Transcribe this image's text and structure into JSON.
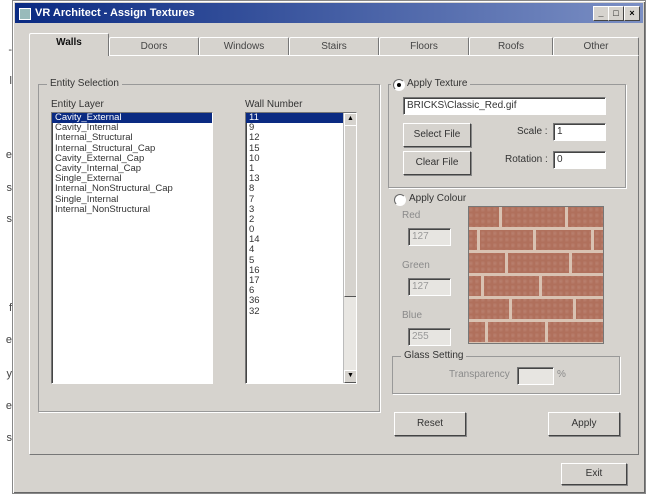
{
  "side_fragments": [
    {
      "text": "-"
    },
    {
      "text": "l"
    },
    {
      "text": "e"
    },
    {
      "text": "s"
    },
    {
      "text": "s"
    },
    {
      "text": "f"
    },
    {
      "text": "e"
    },
    {
      "text": "y"
    },
    {
      "text": "e"
    },
    {
      "text": "s"
    }
  ],
  "window": {
    "title": "VR Architect - Assign Textures",
    "buttons": {
      "minimize": "_",
      "maximize": "□",
      "close": "×"
    }
  },
  "tabs": [
    {
      "label": "Walls",
      "active": true
    },
    {
      "label": "Doors",
      "active": false
    },
    {
      "label": "Windows",
      "active": false
    },
    {
      "label": "Stairs",
      "active": false
    },
    {
      "label": "Floors",
      "active": false
    },
    {
      "label": "Roofs",
      "active": false
    },
    {
      "label": "Other",
      "active": false
    }
  ],
  "entity_selection": {
    "title": "Entity Selection",
    "entity_layer_label": "Entity Layer",
    "wall_number_label": "Wall Number",
    "entity_layers": [
      {
        "label": "Cavity_External",
        "selected": true
      },
      {
        "label": "Cavity_Internal",
        "selected": false
      },
      {
        "label": "Internal_Structural",
        "selected": false
      },
      {
        "label": "Internal_Structural_Cap",
        "selected": false
      },
      {
        "label": "Cavity_External_Cap",
        "selected": false
      },
      {
        "label": "Cavity_Internal_Cap",
        "selected": false
      },
      {
        "label": "Single_External",
        "selected": false
      },
      {
        "label": "Internal_NonStructural_Cap",
        "selected": false
      },
      {
        "label": "Single_Internal",
        "selected": false
      },
      {
        "label": "Internal_NonStructural",
        "selected": false
      }
    ],
    "wall_numbers": [
      {
        "label": "11",
        "selected": true
      },
      {
        "label": "9",
        "selected": false
      },
      {
        "label": "12",
        "selected": false
      },
      {
        "label": "15",
        "selected": false
      },
      {
        "label": "10",
        "selected": false
      },
      {
        "label": "1",
        "selected": false
      },
      {
        "label": "13",
        "selected": false
      },
      {
        "label": "8",
        "selected": false
      },
      {
        "label": "7",
        "selected": false
      },
      {
        "label": "3",
        "selected": false
      },
      {
        "label": "2",
        "selected": false
      },
      {
        "label": "0",
        "selected": false
      },
      {
        "label": "14",
        "selected": false
      },
      {
        "label": "4",
        "selected": false
      },
      {
        "label": "5",
        "selected": false
      },
      {
        "label": "16",
        "selected": false
      },
      {
        "label": "17",
        "selected": false
      },
      {
        "label": "6",
        "selected": false
      },
      {
        "label": "36",
        "selected": false
      },
      {
        "label": "32",
        "selected": false
      }
    ]
  },
  "apply_texture": {
    "label": "Apply Texture",
    "checked": true,
    "path": "BRICKS\\Classic_Red.gif",
    "select_file": "Select File",
    "clear_file": "Clear File",
    "scale_label": "Scale :",
    "scale_value": "1",
    "rotation_label": "Rotation :",
    "rotation_value": "0"
  },
  "apply_colour": {
    "label": "Apply Colour",
    "checked": false,
    "red_label": "Red",
    "red_value": "127",
    "green_label": "Green",
    "green_value": "127",
    "blue_label": "Blue",
    "blue_value": "255",
    "preview": "brick-texture-preview"
  },
  "glass_setting": {
    "title": "Glass Setting",
    "transparency_label": "Transparency",
    "transparency_value": "",
    "unit": "%"
  },
  "actions": {
    "reset": "Reset",
    "apply": "Apply",
    "exit": "Exit"
  }
}
